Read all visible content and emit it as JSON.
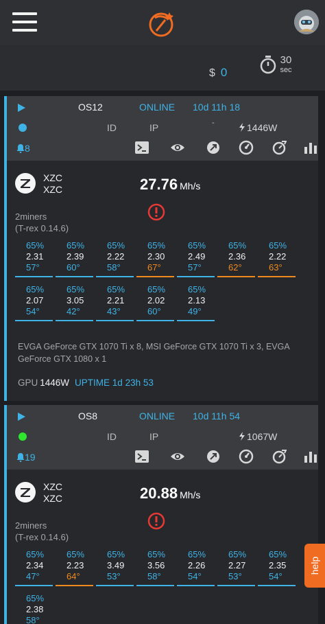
{
  "header": {
    "menu_icon": "hamburger-icon",
    "logo_icon": "pickaxe-logo-icon",
    "avatar_icon": "user-avatar-icon"
  },
  "balance": {
    "currency": "$",
    "amount": "0"
  },
  "refresh": {
    "value": "30",
    "unit": "sec"
  },
  "colors": {
    "accent": "#3fb3e6",
    "warn": "#ef8a1f",
    "alert": "#e53935",
    "online": "#2ee62e",
    "help": "#ef6c22"
  },
  "rigs": [
    {
      "name": "OS12",
      "status": "ONLINE",
      "age": "10d 11h 18",
      "status_dot_color": "#3fb3e6",
      "id_label": "ID",
      "ip_label": "IP",
      "ip_value": "-",
      "power": "1446W",
      "notifications": "8",
      "coin": {
        "line1": "XZC",
        "line2": "XZC",
        "icon": "zcoin-icon"
      },
      "hashrate": "27.76",
      "hash_unit": "Mh/s",
      "miner": "2miners",
      "miner_version": "(T-rex 0.14.6)",
      "gpus": [
        {
          "fan": "65%",
          "hash": "2.31",
          "temp": "57°",
          "hot": false
        },
        {
          "fan": "65%",
          "hash": "2.39",
          "temp": "60°",
          "hot": false
        },
        {
          "fan": "65%",
          "hash": "2.22",
          "temp": "58°",
          "hot": false
        },
        {
          "fan": "65%",
          "hash": "2.30",
          "temp": "67°",
          "hot": true
        },
        {
          "fan": "65%",
          "hash": "2.49",
          "temp": "57°",
          "hot": false
        },
        {
          "fan": "65%",
          "hash": "2.36",
          "temp": "62°",
          "hot": true
        },
        {
          "fan": "65%",
          "hash": "2.22",
          "temp": "63°",
          "hot": true
        },
        {
          "fan": "65%",
          "hash": "2.07",
          "temp": "54°",
          "hot": false
        },
        {
          "fan": "65%",
          "hash": "3.05",
          "temp": "42°",
          "hot": false
        },
        {
          "fan": "65%",
          "hash": "2.21",
          "temp": "43°",
          "hot": false
        },
        {
          "fan": "65%",
          "hash": "2.02",
          "temp": "60°",
          "hot": false
        },
        {
          "fan": "65%",
          "hash": "2.13",
          "temp": "49°",
          "hot": false
        }
      ],
      "models": "EVGA GeForce GTX 1070 Ti x 8, MSI GeForce GTX 1070 Ti x 3, EVGA GeForce GTX 1080 x 1",
      "gpu_label": "GPU",
      "gpu_power": "1446W",
      "uptime": "UPTIME 1d 23h 53"
    },
    {
      "name": "OS8",
      "status": "ONLINE",
      "age": "10d 11h 54",
      "status_dot_color": "#2ee62e",
      "id_label": "ID",
      "ip_label": "IP",
      "ip_value": "",
      "power": "1067W",
      "notifications": "19",
      "coin": {
        "line1": "XZC",
        "line2": "XZC",
        "icon": "zcoin-icon"
      },
      "hashrate": "20.88",
      "hash_unit": "Mh/s",
      "miner": "2miners",
      "miner_version": "(T-rex 0.14.6)",
      "gpus": [
        {
          "fan": "65%",
          "hash": "2.34",
          "temp": "47°",
          "hot": false
        },
        {
          "fan": "65%",
          "hash": "2.23",
          "temp": "64°",
          "hot": true
        },
        {
          "fan": "65%",
          "hash": "3.49",
          "temp": "53°",
          "hot": false
        },
        {
          "fan": "65%",
          "hash": "3.56",
          "temp": "58°",
          "hot": false
        },
        {
          "fan": "65%",
          "hash": "2.26",
          "temp": "54°",
          "hot": false
        },
        {
          "fan": "65%",
          "hash": "2.27",
          "temp": "53°",
          "hot": false
        },
        {
          "fan": "65%",
          "hash": "2.35",
          "temp": "54°",
          "hot": false
        },
        {
          "fan": "65%",
          "hash": "2.38",
          "temp": "58°",
          "hot": false
        }
      ]
    }
  ],
  "tools": [
    "terminal-icon",
    "eye-icon",
    "overclock-icon",
    "speedometer-icon",
    "wrench-gauge-icon",
    "stats-bars-icon"
  ],
  "help_label": "help"
}
